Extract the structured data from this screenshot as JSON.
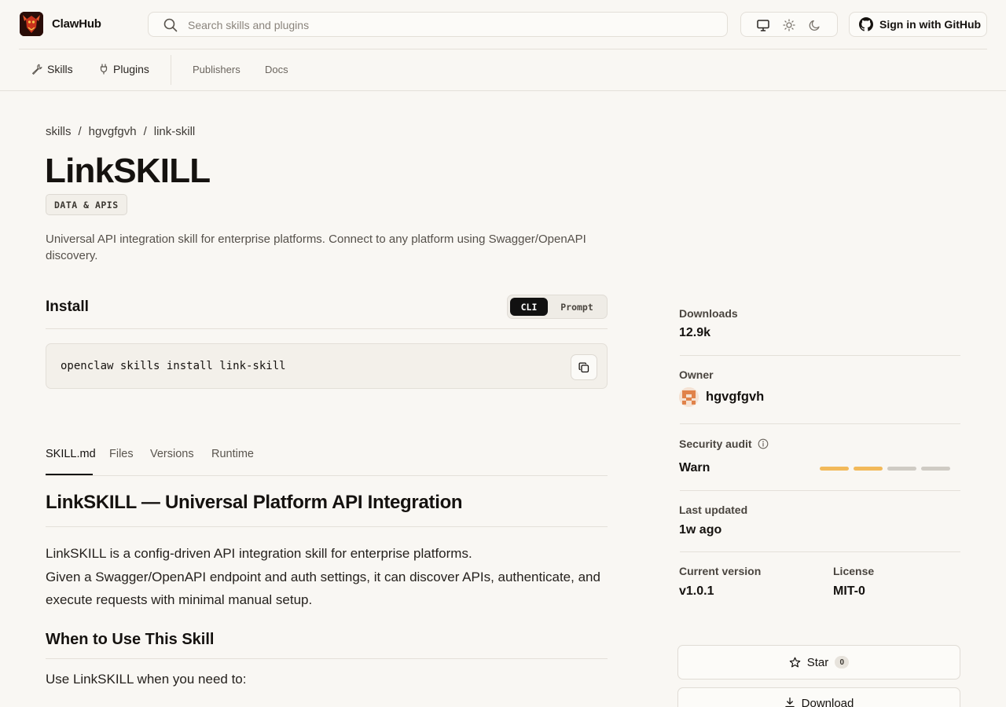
{
  "header": {
    "brand": "ClawHub",
    "search_placeholder": "Search skills and plugins",
    "signin_label": "Sign in with GitHub"
  },
  "nav": {
    "primary": [
      "Skills",
      "Plugins"
    ],
    "secondary": [
      "Publishers",
      "Docs"
    ]
  },
  "breadcrumb": [
    "skills",
    "hgvgfgvh",
    "link-skill"
  ],
  "breadcrumb_sep": "/",
  "skill": {
    "title": "LinkSKILL",
    "category": "DATA & APIS",
    "description": "Universal API integration skill for enterprise platforms. Connect to any platform using Swagger/OpenAPI discovery."
  },
  "install": {
    "heading": "Install",
    "modes": [
      "CLI",
      "Prompt"
    ],
    "selected_mode": "CLI",
    "command": "openclaw skills install link-skill"
  },
  "tabs": {
    "items": [
      "SKILL.md",
      "Files",
      "Versions",
      "Runtime"
    ],
    "active": "SKILL.md"
  },
  "doc": {
    "h1": "LinkSKILL — Universal Platform API Integration",
    "p1_line1": "LinkSKILL is a config-driven API integration skill for enterprise platforms.",
    "p1_line2": "Given a Swagger/OpenAPI endpoint and auth settings, it can discover APIs, authenticate, and execute requests with minimal manual setup.",
    "h2": "When to Use This Skill",
    "p2": "Use LinkSKILL when you need to:"
  },
  "sidebar": {
    "downloads_label": "Downloads",
    "downloads_value": "12.9k",
    "owner_label": "Owner",
    "owner_name": "hgvgfgvh",
    "security_label": "Security audit",
    "security_value": "Warn",
    "security_level": 2,
    "security_level_max": 4,
    "last_updated_label": "Last updated",
    "last_updated_value": "1w ago",
    "version_label": "Current version",
    "version_value": "v1.0.1",
    "license_label": "License",
    "license_value": "MIT-0",
    "star_label": "Star",
    "star_count": "0",
    "download_label": "Download"
  },
  "colors": {
    "background": "#f9f7f3",
    "text": "#15120f",
    "warn": "#f2b95a",
    "meter_empty": "#cfcbc4",
    "accent_dark": "#111111"
  },
  "icons": [
    "search-icon",
    "monitor-icon",
    "sun-icon",
    "moon-icon",
    "github-icon",
    "wrench-icon",
    "plug-icon",
    "copy-icon",
    "info-icon",
    "star-icon",
    "download-icon"
  ]
}
